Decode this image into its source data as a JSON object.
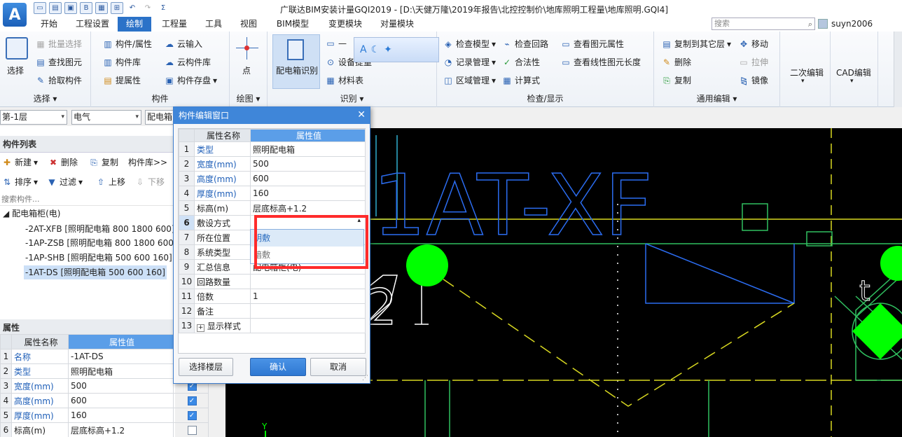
{
  "title_bar": {
    "app_logo": "A",
    "window_title": "广联达BIM安装计量GQI2019 - [D:\\天健万隆\\2019年报告\\北控控制价\\地库照明工程量\\地库照明.GQI4]"
  },
  "menu": {
    "tabs": [
      "开始",
      "工程设置",
      "绘制",
      "工程量",
      "工具",
      "视图",
      "BIM模型",
      "变更模块",
      "对量模块"
    ],
    "active_tab": "绘制",
    "search_placeholder": "搜索",
    "user": "suyn2006"
  },
  "ribbon": {
    "select_group": {
      "label": "选择",
      "select": "选择",
      "batch_select": "批量选择",
      "find_element": "查找图元",
      "pick_component": "拾取构件"
    },
    "component_group": {
      "label": "构件",
      "comp_attr": "构件/属性",
      "comp_lib": "构件库",
      "extract_attr": "提属性",
      "cloud_input": "云输入",
      "cloud_comp_lib": "云构件库",
      "comp_save": "构件存盘"
    },
    "draw_group": {
      "label": "绘图",
      "point": "点"
    },
    "recognize_group": {
      "label": "识别",
      "dist_box_recognize": "配电箱识别",
      "device_recognize": "设备提量",
      "material_table": "材料表"
    },
    "check_group": {
      "label": "检查/显示",
      "check_model": "检查模型",
      "record_manage": "记录管理",
      "area_manage": "区域管理",
      "check_circuit": "检查回路",
      "legality": "合法性",
      "formula": "计算式",
      "view_elem_attr": "查看图元属性",
      "view_line_length": "查看线性图元长度"
    },
    "edit_group": {
      "label": "通用编辑",
      "copy_to_floor": "复制到其它层",
      "delete": "删除",
      "copy": "复制",
      "move": "移动",
      "stretch": "拉伸",
      "mirror": "镜像"
    },
    "secondary_edit": "二次编辑",
    "cad_edit": "CAD编辑"
  },
  "floorbar": {
    "floor": "第-1层",
    "major": "电气",
    "type": "配电箱"
  },
  "component_list": {
    "header": "构件列表",
    "tools": {
      "new": "新建",
      "delete": "删除",
      "copy": "复制",
      "lib": "构件库>>",
      "sort": "排序",
      "filter": "过滤",
      "move_up": "上移",
      "move_down": "下移"
    },
    "search_placeholder": "搜索构件...",
    "root": "配电箱柜(电)",
    "items": [
      "-2AT-XFB [照明配电箱 800 1800 600]",
      "-1AP-ZSB [照明配电箱 800 1800 600]",
      "-1AP-SHB [照明配电箱 500 600 160]",
      "-1AT-DS [照明配电箱 500 600 160]"
    ]
  },
  "properties": {
    "header": "属性",
    "col_name": "属性名称",
    "col_value": "属性值",
    "rows": [
      {
        "n": "1",
        "name": "名称",
        "value": "-1AT-DS",
        "check": ""
      },
      {
        "n": "2",
        "name": "类型",
        "value": "照明配电箱",
        "check": ""
      },
      {
        "n": "3",
        "name": "宽度(mm)",
        "value": "500",
        "check": "on"
      },
      {
        "n": "4",
        "name": "高度(mm)",
        "value": "600",
        "check": "on"
      },
      {
        "n": "5",
        "name": "厚度(mm)",
        "value": "160",
        "check": "on"
      },
      {
        "n": "6",
        "name": "标高(m)",
        "value": "层底标高+1.2",
        "check": "off"
      }
    ]
  },
  "dialog": {
    "title": "构件编辑窗口",
    "col_name": "属性名称",
    "col_value": "属性值",
    "rows": [
      {
        "n": "1",
        "name": "类型",
        "value": "照明配电箱"
      },
      {
        "n": "2",
        "name": "宽度(mm)",
        "value": "500"
      },
      {
        "n": "3",
        "name": "高度(mm)",
        "value": "600"
      },
      {
        "n": "4",
        "name": "厚度(mm)",
        "value": "160"
      },
      {
        "n": "5",
        "name": "标高(m)",
        "value": "层底标高+1.2"
      },
      {
        "n": "6",
        "name": "敷设方式",
        "value": ""
      },
      {
        "n": "7",
        "name": "所在位置",
        "value": ""
      },
      {
        "n": "8",
        "name": "系统类型",
        "value": ""
      },
      {
        "n": "9",
        "name": "汇总信息",
        "value": "配电箱柜(电)"
      },
      {
        "n": "10",
        "name": "回路数量",
        "value": ""
      },
      {
        "n": "11",
        "name": "倍数",
        "value": "1"
      },
      {
        "n": "12",
        "name": "备注",
        "value": ""
      },
      {
        "n": "13",
        "name": "显示样式",
        "value": ""
      }
    ],
    "dropdown_options": [
      "明敷",
      "暗敷"
    ],
    "select_floor": "选择楼层",
    "ok": "确认",
    "cancel": "取消"
  },
  "cad": {
    "label_text": "1AT-XF",
    "side_text": "2",
    "side_text2": "t",
    "axis_y": "Y"
  }
}
